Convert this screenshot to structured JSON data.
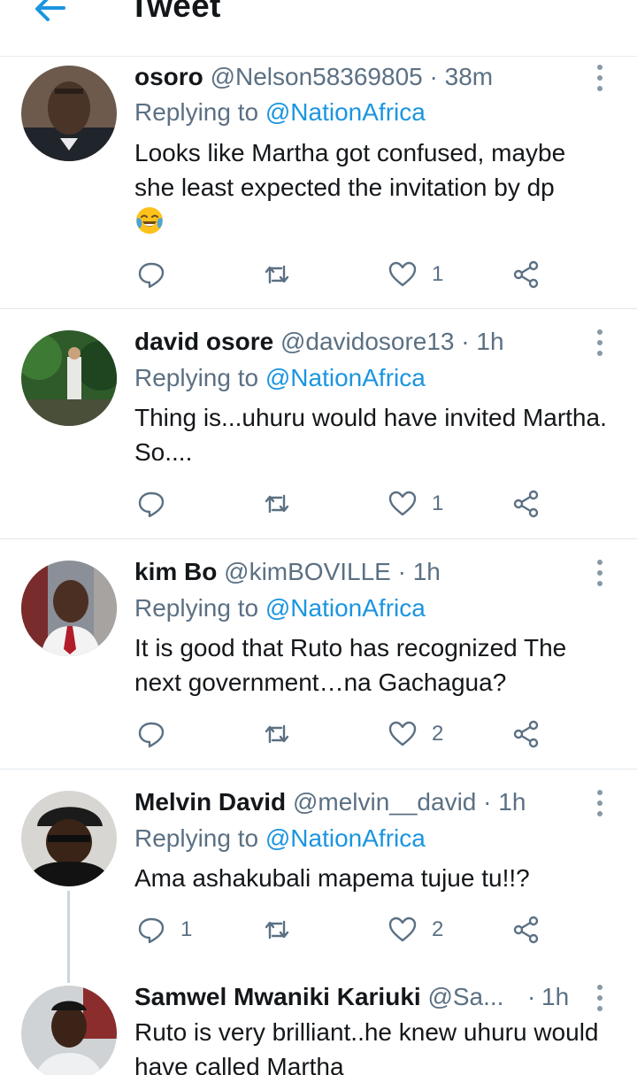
{
  "header": {
    "title": "Tweet",
    "back_icon": "arrow-left-icon"
  },
  "colors": {
    "accent": "#1b95e0",
    "secondary_text": "#5b7083",
    "divider": "#e1e8ed"
  },
  "tweets": [
    {
      "name": "osoro",
      "handle": "@Nelson58369805",
      "dot": "·",
      "time": "38m",
      "replying_prefix": "Replying to",
      "replying_to": "@NationAfrica",
      "text": "Looks like Martha got confused, maybe she least expected the invitation by dp",
      "emoji": "face-with-tears-of-joy",
      "reply_count": "",
      "retweet_count": "",
      "like_count": "1"
    },
    {
      "name": "david osore",
      "handle": "@davidosore13",
      "dot": "·",
      "time": "1h",
      "replying_prefix": "Replying to",
      "replying_to": "@NationAfrica",
      "text": "Thing is...uhuru would have invited Martha.  So....",
      "reply_count": "",
      "retweet_count": "",
      "like_count": "1"
    },
    {
      "name": "kim Bo",
      "handle": "@kimBOVILLE",
      "dot": "·",
      "time": "1h",
      "replying_prefix": "Replying to",
      "replying_to": "@NationAfrica",
      "text": "It is good that Ruto has recognized The next government…na Gachagua?",
      "reply_count": "",
      "retweet_count": "",
      "like_count": "2"
    },
    {
      "name": "Melvin David",
      "handle": "@melvin__david",
      "dot": "·",
      "time": "1h",
      "replying_prefix": "Replying to",
      "replying_to": "@NationAfrica",
      "text": "Ama ashakubali mapema tujue tu!!?",
      "reply_count": "1",
      "retweet_count": "",
      "like_count": "2"
    },
    {
      "name": "Samwel Mwaniki Kariuki",
      "handle": "@Sa...",
      "dot": "·",
      "time": "1h",
      "text": "Ruto is very brilliant..he knew uhuru would have called Martha"
    }
  ]
}
